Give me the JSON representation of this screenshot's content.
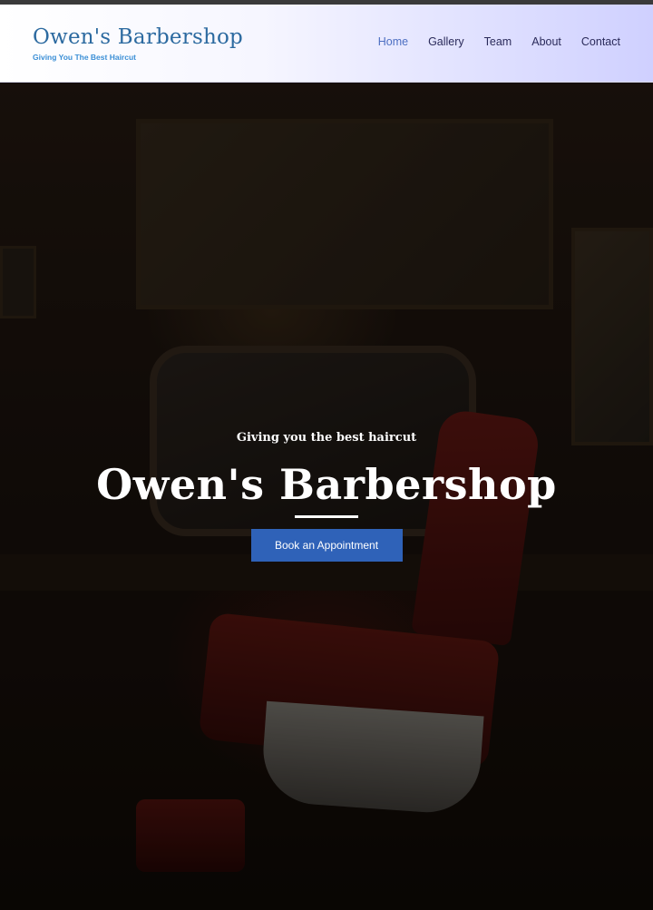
{
  "header": {
    "brand_title": "Owen's Barbershop",
    "brand_tagline": "Giving You The Best Haircut",
    "nav": [
      {
        "label": "Home",
        "active": true
      },
      {
        "label": "Gallery",
        "active": false
      },
      {
        "label": "Team",
        "active": false
      },
      {
        "label": "About",
        "active": false
      },
      {
        "label": "Contact",
        "active": false
      }
    ]
  },
  "hero": {
    "subtitle": "Giving you the best haircut",
    "title": "Owen's Barbershop",
    "cta_label": "Book an Appointment"
  },
  "colors": {
    "brand": "#2c6aa0",
    "tagline": "#3b8fd6",
    "nav_text": "#2a2a5a",
    "nav_active": "#4d6fc2",
    "cta": "#2f62b8"
  }
}
